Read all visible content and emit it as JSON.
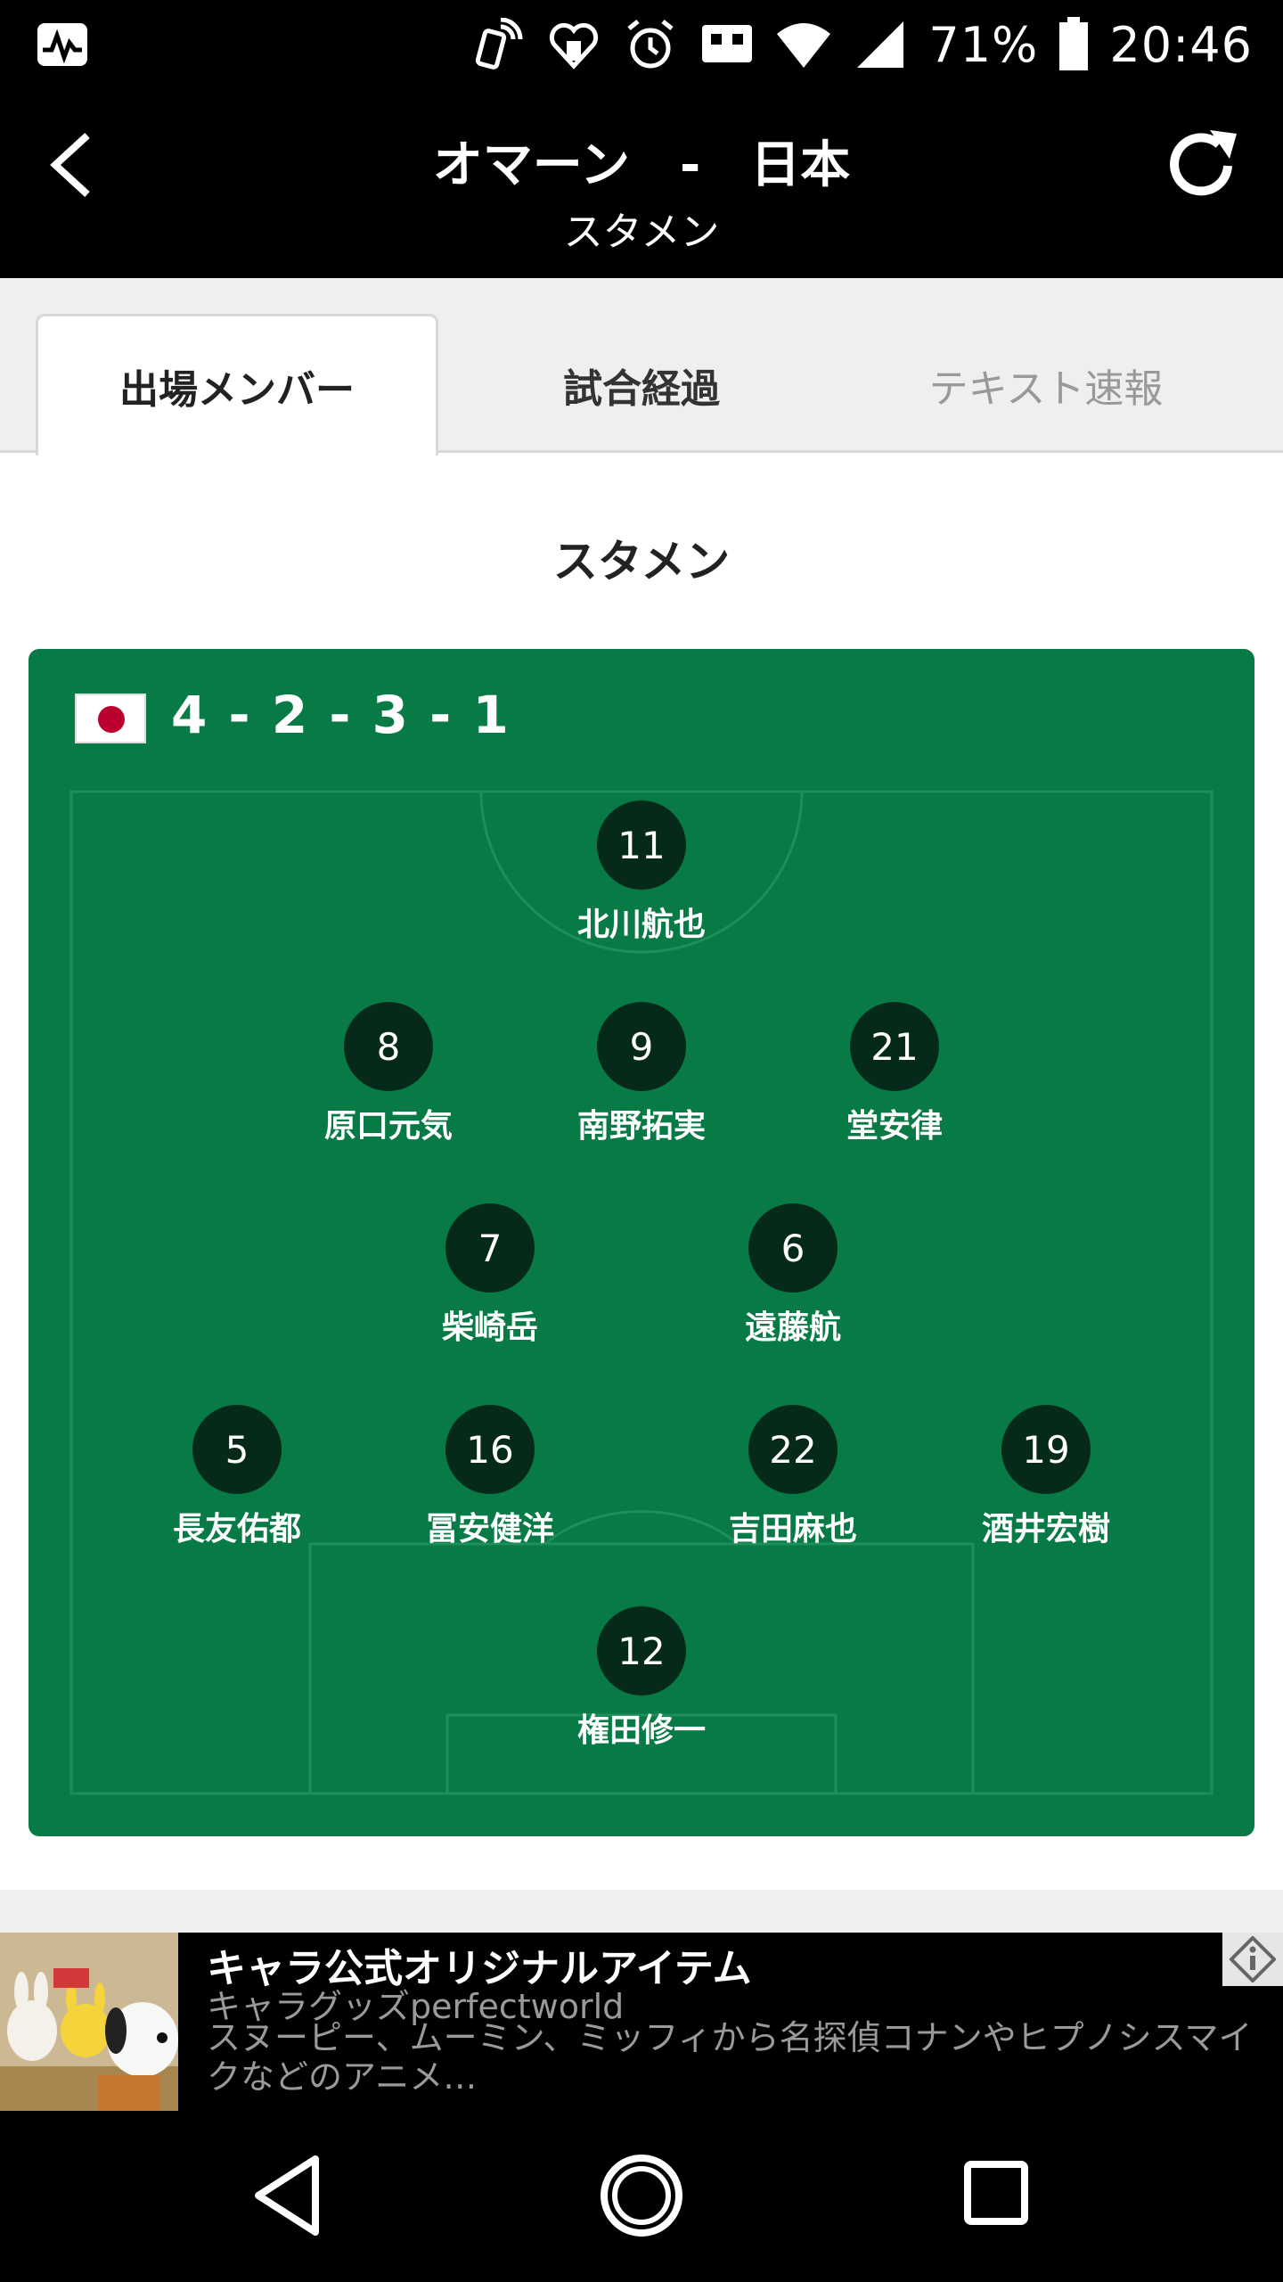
{
  "status_bar": {
    "battery": "71%",
    "time": "20:46",
    "icons": [
      "activity-icon",
      "nfc-icon",
      "health-icon",
      "alarm-icon",
      "vibrate-icon",
      "wifi-icon",
      "signal-icon",
      "battery-icon"
    ]
  },
  "header": {
    "title": "オマーン　-　日本",
    "subtitle": "スタメン"
  },
  "tabs": [
    {
      "label": "出場メンバー",
      "active": true
    },
    {
      "label": "試合経過",
      "active": false
    },
    {
      "label": "テキスト速報",
      "active": false
    }
  ],
  "section_title": "スタメン",
  "lineup": {
    "formation": "4 - 2 - 3 - 1",
    "team_flag": "japan-flag-icon",
    "players": [
      {
        "number": "11",
        "name": "北川航也"
      },
      {
        "number": "8",
        "name": "原口元気"
      },
      {
        "number": "9",
        "name": "南野拓実"
      },
      {
        "number": "21",
        "name": "堂安律"
      },
      {
        "number": "7",
        "name": "柴崎岳"
      },
      {
        "number": "6",
        "name": "遠藤航"
      },
      {
        "number": "5",
        "name": "長友佑都"
      },
      {
        "number": "16",
        "name": "冨安健洋"
      },
      {
        "number": "22",
        "name": "吉田麻也"
      },
      {
        "number": "19",
        "name": "酒井宏樹"
      },
      {
        "number": "12",
        "name": "権田修一"
      }
    ]
  },
  "ad": {
    "title": "キャラ公式オリジナルアイテム",
    "sponsor": "キャラグッズperfectworld",
    "description": "スヌーピー、ムーミン、ミッフィから名探偵コナンやヒプノシスマイクなどのアニメ…"
  },
  "colors": {
    "pitch": "#077a45",
    "player_circle": "#062a1a",
    "header_bg": "#000000",
    "tab_strip": "#efefef"
  }
}
